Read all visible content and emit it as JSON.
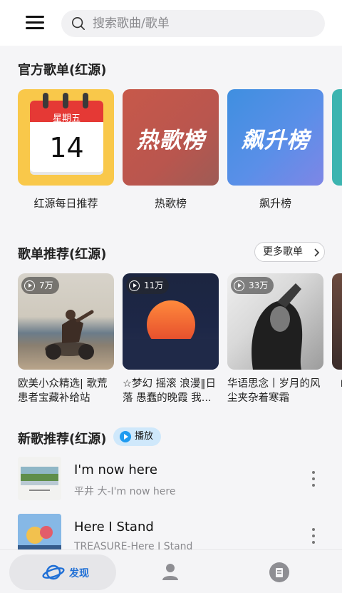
{
  "header": {
    "search_placeholder": "搜索歌曲/歌单"
  },
  "official": {
    "title": "官方歌单(红源)",
    "items": [
      {
        "label": "红源每日推荐",
        "weekday": "星期五",
        "day": "14"
      },
      {
        "label": "热歌榜",
        "cover_text": "热歌榜"
      },
      {
        "label": "飙升榜",
        "cover_text": "飙升榜"
      }
    ]
  },
  "recommend": {
    "title": "歌单推荐(红源)",
    "more_label": "更多歌单",
    "items": [
      {
        "plays": "7万",
        "label": "欧美小众精选| 歌荒患者宝藏补给站"
      },
      {
        "plays": "11万",
        "label": "☆梦幻 摇滚 浪漫‖日落 愚蠢的晚霞 我..."
      },
      {
        "plays": "33万",
        "label": "华语思念丨岁月的风尘夹杂着寒霜"
      }
    ],
    "partial_label": "「"
  },
  "new_songs": {
    "title": "新歌推荐(红源)",
    "play_label": "播放",
    "items": [
      {
        "title": "I'm now here",
        "subtitle": "平井 大-I'm now here"
      },
      {
        "title": "Here I Stand",
        "subtitle": "TREASURE-Here I Stand"
      }
    ]
  },
  "nav": {
    "discover_label": "发现"
  },
  "colors": {
    "accent": "#1f9bf0",
    "nav_active": "#1f6fd6"
  }
}
